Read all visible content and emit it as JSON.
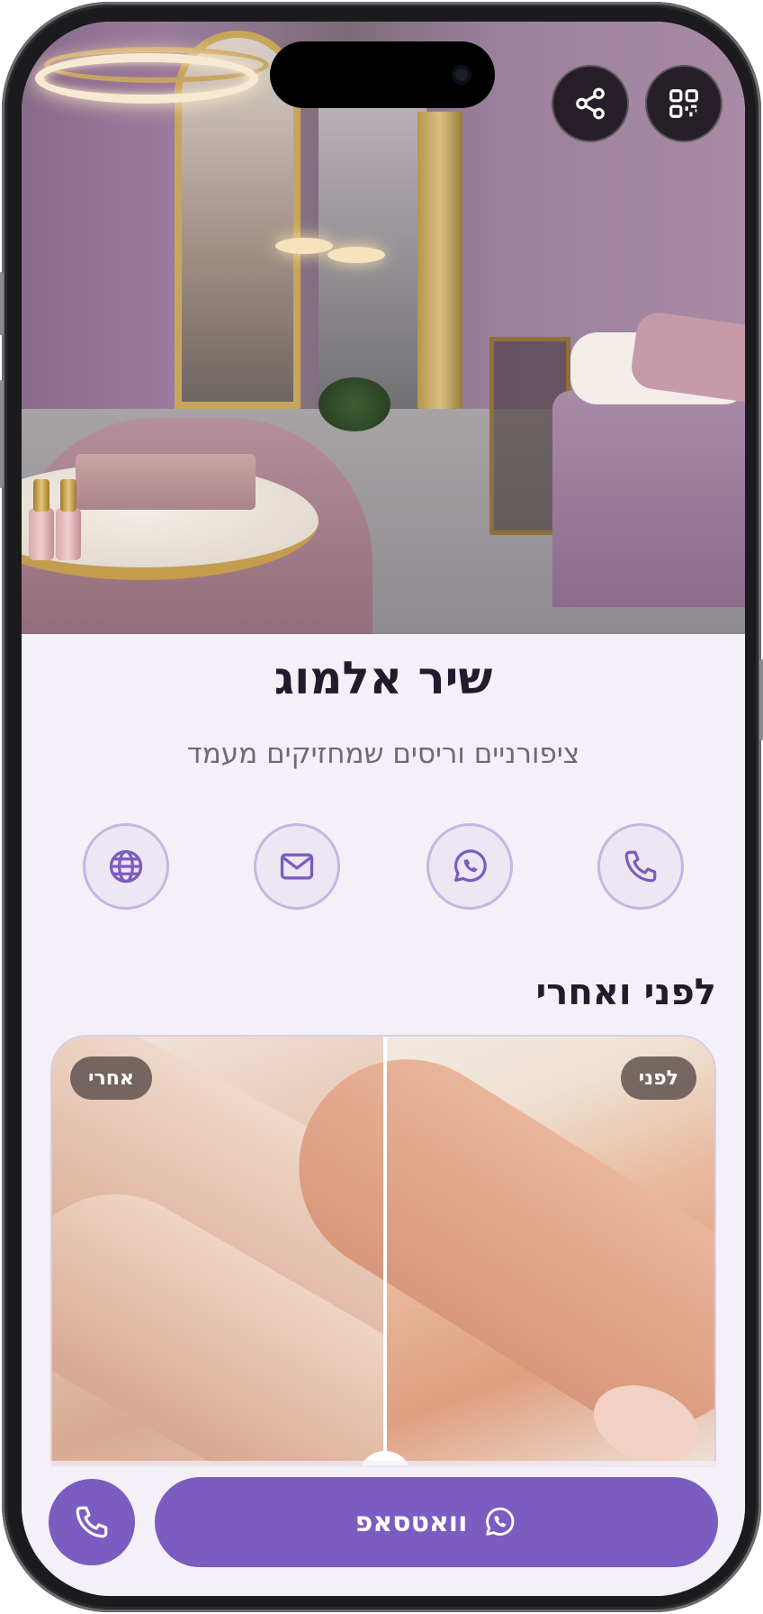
{
  "profile": {
    "name": "שיר אלמוג",
    "tagline": "ציפורניים וריסים שמחזיקים מעמד"
  },
  "top_actions": [
    {
      "icon": "qr-code-icon"
    },
    {
      "icon": "share-icon"
    }
  ],
  "contact_actions": [
    {
      "icon": "phone-icon"
    },
    {
      "icon": "whatsapp-icon"
    },
    {
      "icon": "mail-icon"
    },
    {
      "icon": "globe-icon"
    }
  ],
  "before_after": {
    "title": "לפני ואחרי",
    "before_label": "לפני",
    "after_label": "אחרי"
  },
  "bottom_bar": {
    "whatsapp_label": "וואטסאפ",
    "call_icon": "phone-icon"
  },
  "colors": {
    "accent": "#7b5cc0",
    "accent_light": "#c5b6e2",
    "background": "#f3f0f8",
    "text_dark": "#231a2e",
    "text_muted": "#6f6878"
  }
}
